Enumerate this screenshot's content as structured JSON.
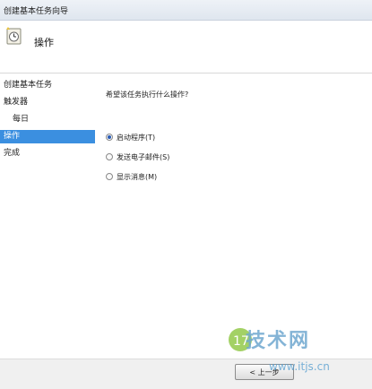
{
  "window": {
    "title": "创建基本任务向导"
  },
  "header": {
    "title": "操作",
    "icon": "task-clock-icon"
  },
  "sidebar": {
    "items": [
      {
        "label": "创建基本任务",
        "active": false,
        "indent": false
      },
      {
        "label": "触发器",
        "active": false,
        "indent": false
      },
      {
        "label": "每日",
        "active": false,
        "indent": true
      },
      {
        "label": "操作",
        "active": true,
        "indent": false
      },
      {
        "label": "完成",
        "active": false,
        "indent": false
      }
    ]
  },
  "main": {
    "question": "希望该任务执行什么操作?",
    "options": [
      {
        "label": "启动程序(T)",
        "checked": true
      },
      {
        "label": "发送电子邮件(S)",
        "checked": false
      },
      {
        "label": "显示消息(M)",
        "checked": false
      }
    ]
  },
  "footer": {
    "back_label": "< 上一步"
  },
  "watermark": {
    "brand": "技术网",
    "number": "17",
    "site": "www.itjs.cn"
  },
  "colors": {
    "accent": "#3b8fe0",
    "watermark": "#6fa8cf"
  }
}
